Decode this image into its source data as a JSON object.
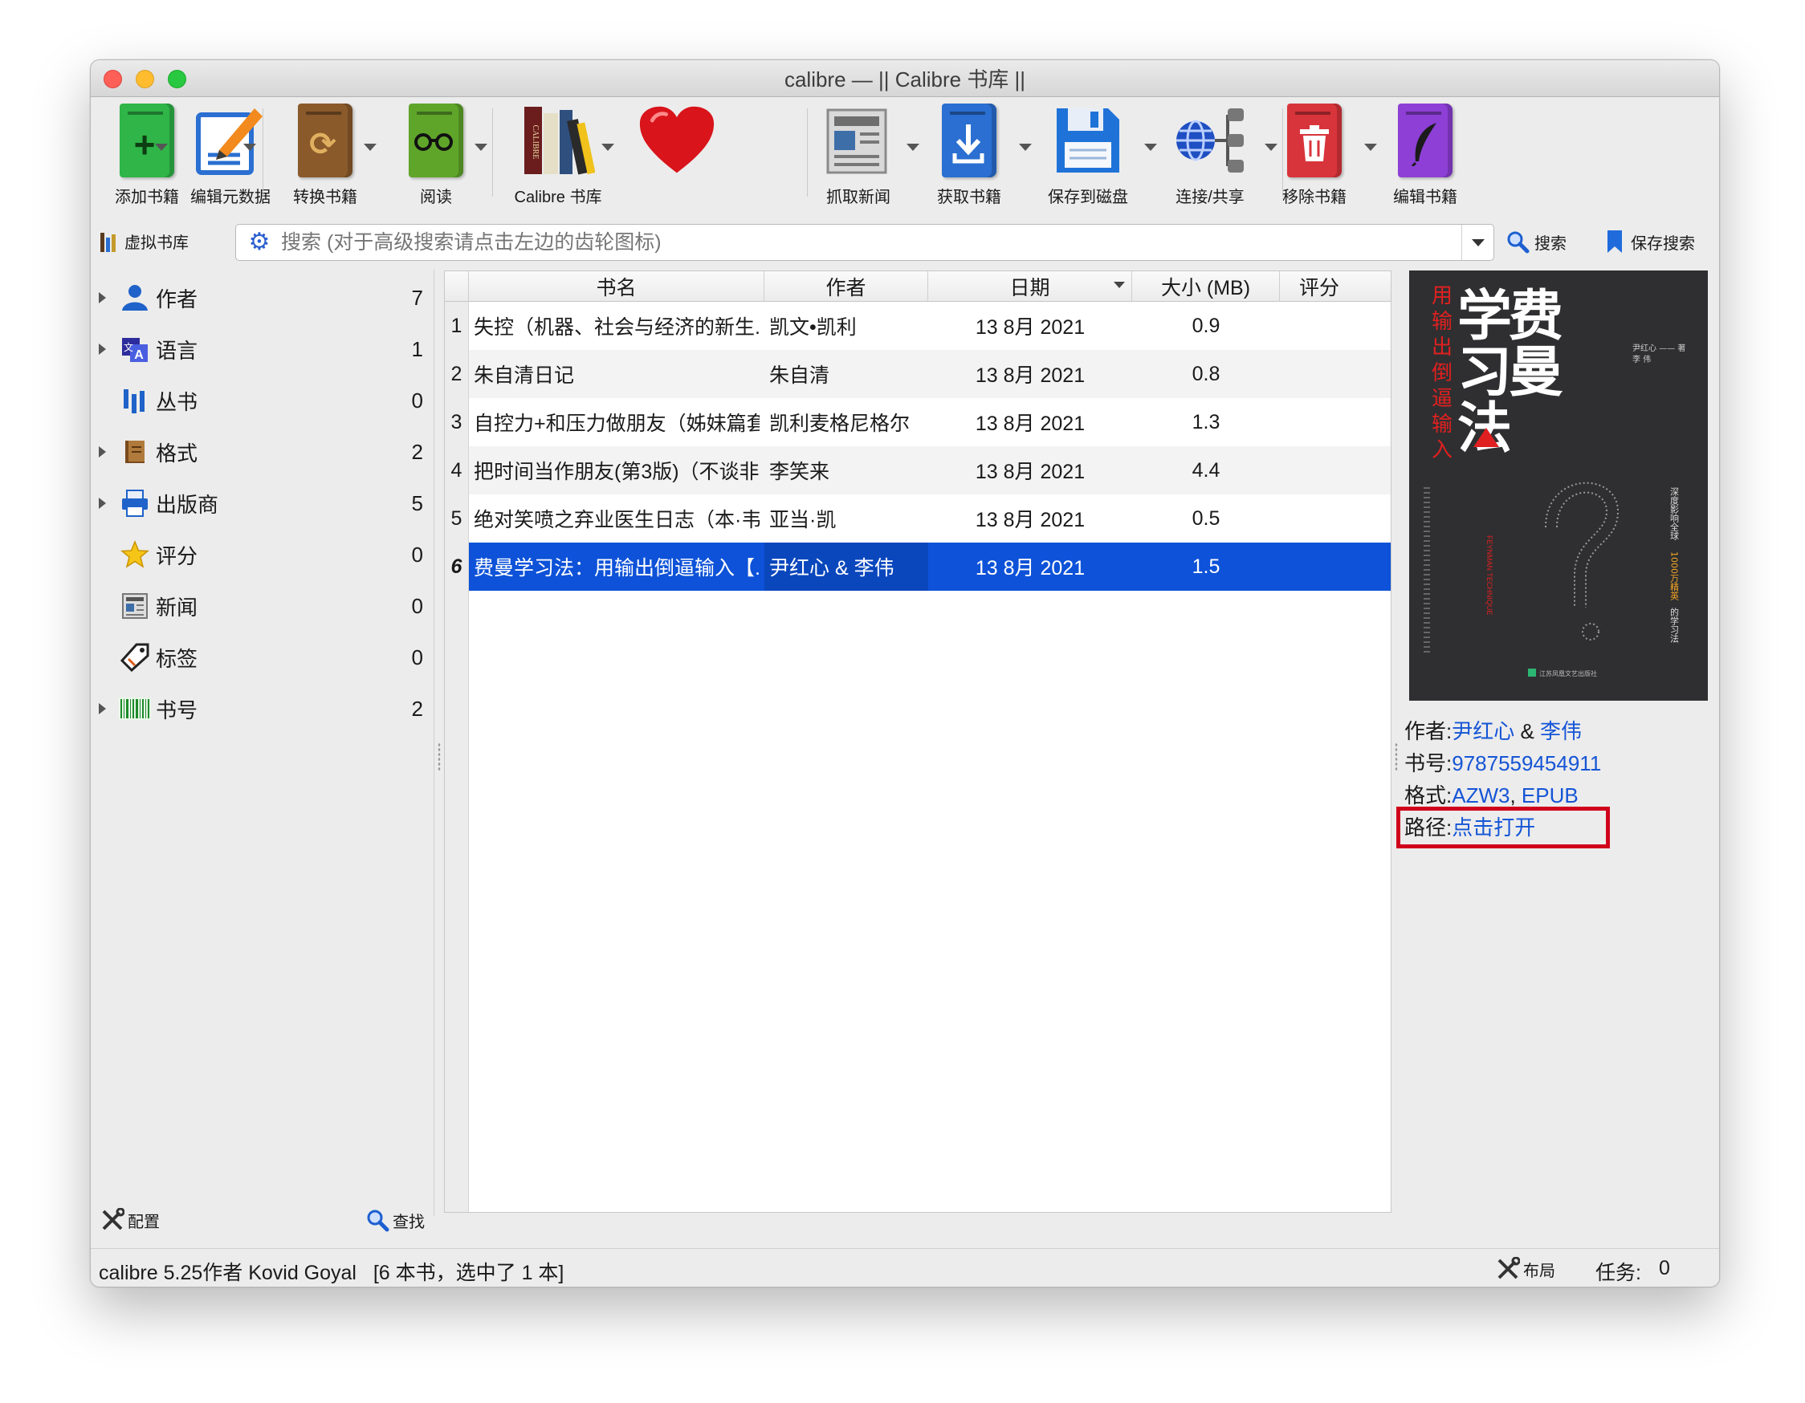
{
  "window": {
    "title": "calibre — || Calibre 书库 ||"
  },
  "toolbar": {
    "items": [
      {
        "label": "添加书籍",
        "icon": "add-book-icon",
        "color": "#2fb548"
      },
      {
        "label": "编辑元数据",
        "icon": "edit-metadata-icon",
        "color": "#2a6fd1"
      },
      {
        "label": "转换书籍",
        "icon": "convert-book-icon",
        "color": "#8a5a2b"
      },
      {
        "label": "阅读",
        "icon": "read-book-icon",
        "color": "#5fa52a"
      },
      {
        "label": "Calibre 书库",
        "icon": "calibre-library-icon",
        "color": "#6b1d1d"
      },
      {
        "label": "",
        "icon": "donate-heart-icon",
        "color": "#d9141b"
      },
      {
        "label": "抓取新闻",
        "icon": "fetch-news-icon",
        "color": "#9a9a9a"
      },
      {
        "label": "获取书籍",
        "icon": "get-books-icon",
        "color": "#2a6fd1"
      },
      {
        "label": "保存到磁盘",
        "icon": "save-to-disk-icon",
        "color": "#1f73d8"
      },
      {
        "label": "连接/共享",
        "icon": "connect-share-icon",
        "color": "#1f4fc2"
      },
      {
        "label": "移除书籍",
        "icon": "remove-book-icon",
        "color": "#d8343b"
      },
      {
        "label": "编辑书籍",
        "icon": "edit-book-icon",
        "color": "#8d3fd6"
      }
    ]
  },
  "searchbar": {
    "virtual_library": "虚拟书库",
    "placeholder": "搜索 (对于高级搜索请点击左边的齿轮图标)",
    "search_button": "搜索",
    "save_search_button": "保存搜索"
  },
  "tag_browser": {
    "items": [
      {
        "label": "作者",
        "count": "7",
        "expandable": true,
        "icon": "person-icon"
      },
      {
        "label": "语言",
        "count": "1",
        "expandable": true,
        "icon": "language-icon"
      },
      {
        "label": "丛书",
        "count": "0",
        "expandable": false,
        "icon": "series-icon"
      },
      {
        "label": "格式",
        "count": "2",
        "expandable": true,
        "icon": "format-book-icon"
      },
      {
        "label": "出版商",
        "count": "5",
        "expandable": true,
        "icon": "publisher-icon"
      },
      {
        "label": "评分",
        "count": "0",
        "expandable": false,
        "icon": "star-icon"
      },
      {
        "label": "新闻",
        "count": "0",
        "expandable": false,
        "icon": "news-icon"
      },
      {
        "label": "标签",
        "count": "0",
        "expandable": false,
        "icon": "tag-icon"
      },
      {
        "label": "书号",
        "count": "2",
        "expandable": true,
        "icon": "barcode-icon"
      }
    ],
    "configure": "配置",
    "find": "查找"
  },
  "book_table": {
    "columns": [
      "书名",
      "作者",
      "日期",
      "大小 (MB)",
      "评分"
    ],
    "rows": [
      {
        "num": "1",
        "title": "失控（机器、社会与经济的新生...",
        "author": "凯文•凯利",
        "date": "13 8月 2021",
        "size": "0.9"
      },
      {
        "num": "2",
        "title": "朱自清日记",
        "author": "朱自清",
        "date": "13 8月 2021",
        "size": "0.8"
      },
      {
        "num": "3",
        "title": "自控力+和压力做朋友（姊妹篇套...",
        "author": "凯利麦格尼格尔",
        "date": "13 8月 2021",
        "size": "1.3"
      },
      {
        "num": "4",
        "title": "把时间当作朋友(第3版)（不谈非...",
        "author": "李笑来",
        "date": "13 8月 2021",
        "size": "4.4"
      },
      {
        "num": "5",
        "title": "绝对笑喷之弃业医生日志（本·韦...",
        "author": "亚当·凯",
        "date": "13 8月 2021",
        "size": "0.5"
      },
      {
        "num": "6",
        "title": "费曼学习法：用输出倒逼输入【...",
        "author": "尹红心 & 李伟",
        "date": "13 8月 2021",
        "size": "1.5"
      }
    ],
    "selected_row": 6
  },
  "book_details": {
    "cover": {
      "title_big": "费曼学习法",
      "subtitle_red": "用输出倒逼输入",
      "author_small": "尹红心 李伟 著",
      "side_text": "深度影响全球1000万精英的学习法",
      "publisher": "江苏凤凰文艺出版社"
    },
    "author_label": "作者:",
    "author_1": "尹红心",
    "author_sep": " & ",
    "author_2": "李伟",
    "isbn_label": "书号:",
    "isbn": "9787559454911",
    "formats_label": "格式:",
    "format_1": "AZW3",
    "format_sep": ", ",
    "format_2": "EPUB",
    "path_label": "路径:",
    "path_link": "点击打开"
  },
  "statusbar": {
    "text": "calibre 5.25作者 Kovid Goyal   [6 本书，选中了 1 本]",
    "layout": "布局",
    "jobs_label": "任务:",
    "jobs_count": "0"
  }
}
